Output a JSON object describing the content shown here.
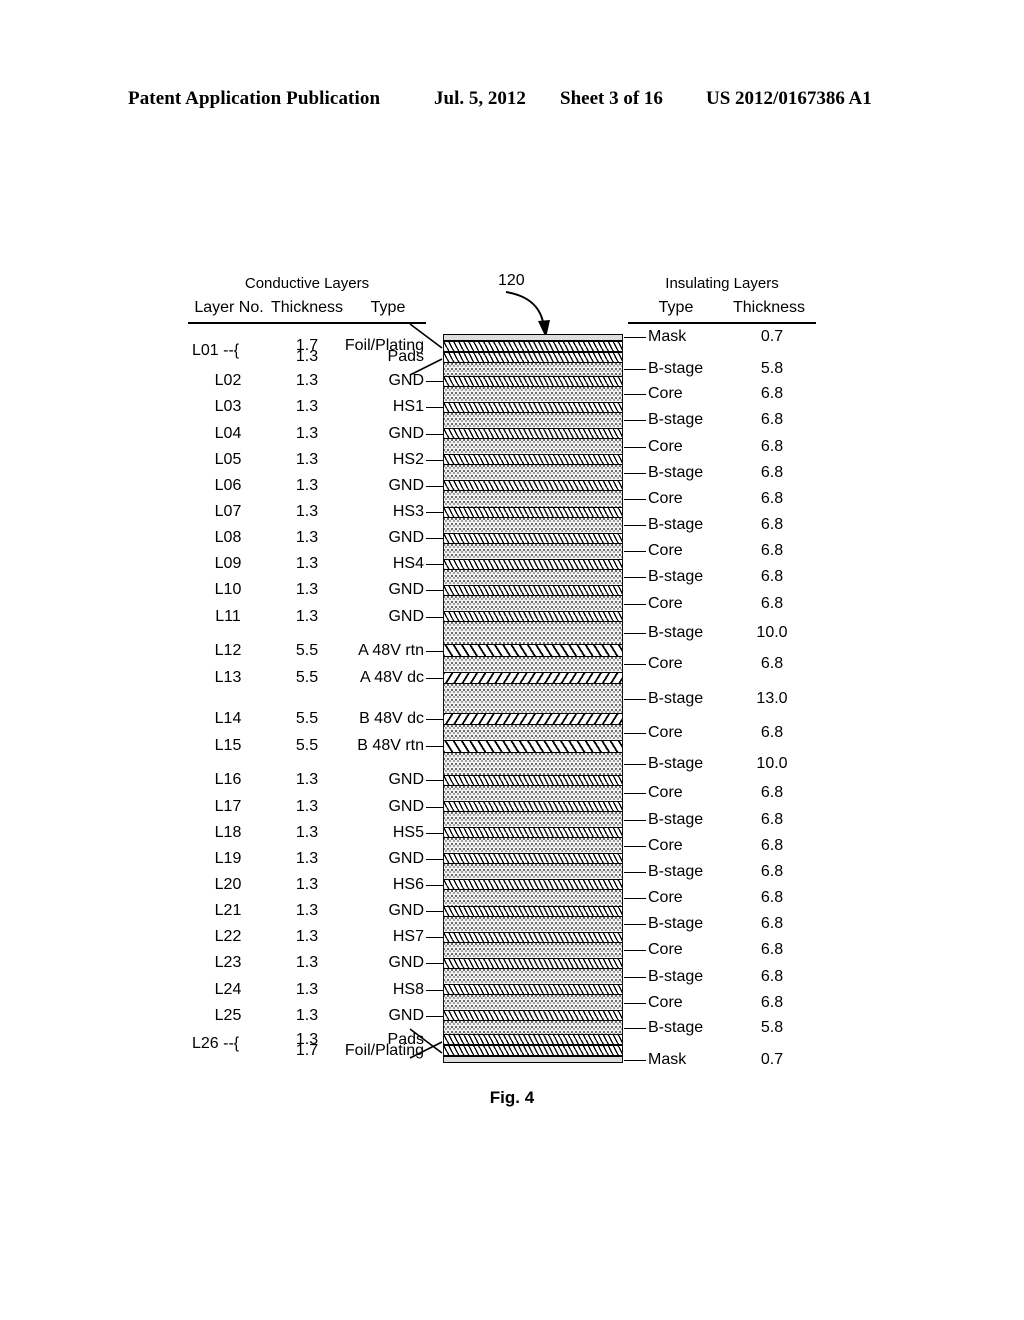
{
  "header": {
    "publication": "Patent Application Publication",
    "date": "Jul. 5, 2012",
    "sheet": "Sheet 3 of 16",
    "patent_number": "US 2012/0167386 A1"
  },
  "figure": {
    "caption": "Fig. 4",
    "callout": "120",
    "conductive_group_title": "Conductive Layers",
    "insulating_group_title": "Insulating Layers",
    "columns": {
      "layer_no": "Layer No.",
      "conductive_thickness": "Thickness",
      "conductive_type": "Type",
      "insulating_type": "Type",
      "insulating_thickness": "Thickness"
    },
    "brace_top_label": "L01 --{",
    "brace_bottom_label": "L26 --{"
  },
  "conductive_layers": [
    {
      "no": "",
      "thickness": "1.7",
      "type": "Foil/Plating"
    },
    {
      "no": "",
      "thickness": "1.3",
      "type": "Pads"
    },
    {
      "no": "L02",
      "thickness": "1.3",
      "type": "GND"
    },
    {
      "no": "L03",
      "thickness": "1.3",
      "type": "HS1"
    },
    {
      "no": "L04",
      "thickness": "1.3",
      "type": "GND"
    },
    {
      "no": "L05",
      "thickness": "1.3",
      "type": "HS2"
    },
    {
      "no": "L06",
      "thickness": "1.3",
      "type": "GND"
    },
    {
      "no": "L07",
      "thickness": "1.3",
      "type": "HS3"
    },
    {
      "no": "L08",
      "thickness": "1.3",
      "type": "GND"
    },
    {
      "no": "L09",
      "thickness": "1.3",
      "type": "HS4"
    },
    {
      "no": "L10",
      "thickness": "1.3",
      "type": "GND"
    },
    {
      "no": "L11",
      "thickness": "1.3",
      "type": "GND"
    },
    {
      "no": "L12",
      "thickness": "5.5",
      "type": "A 48V rtn"
    },
    {
      "no": "L13",
      "thickness": "5.5",
      "type": "A 48V dc"
    },
    {
      "no": "L14",
      "thickness": "5.5",
      "type": "B 48V dc"
    },
    {
      "no": "L15",
      "thickness": "5.5",
      "type": "B 48V rtn"
    },
    {
      "no": "L16",
      "thickness": "1.3",
      "type": "GND"
    },
    {
      "no": "L17",
      "thickness": "1.3",
      "type": "GND"
    },
    {
      "no": "L18",
      "thickness": "1.3",
      "type": "HS5"
    },
    {
      "no": "L19",
      "thickness": "1.3",
      "type": "GND"
    },
    {
      "no": "L20",
      "thickness": "1.3",
      "type": "HS6"
    },
    {
      "no": "L21",
      "thickness": "1.3",
      "type": "GND"
    },
    {
      "no": "L22",
      "thickness": "1.3",
      "type": "HS7"
    },
    {
      "no": "L23",
      "thickness": "1.3",
      "type": "GND"
    },
    {
      "no": "L24",
      "thickness": "1.3",
      "type": "HS8"
    },
    {
      "no": "L25",
      "thickness": "1.3",
      "type": "GND"
    },
    {
      "no": "",
      "thickness": "1.3",
      "type": "Pads"
    },
    {
      "no": "",
      "thickness": "1.7",
      "type": "Foil/Plating"
    }
  ],
  "insulating_layers": [
    {
      "type": "Mask",
      "thickness": "0.7"
    },
    {
      "type": "B-stage",
      "thickness": "5.8"
    },
    {
      "type": "Core",
      "thickness": "6.8"
    },
    {
      "type": "B-stage",
      "thickness": "6.8"
    },
    {
      "type": "Core",
      "thickness": "6.8"
    },
    {
      "type": "B-stage",
      "thickness": "6.8"
    },
    {
      "type": "Core",
      "thickness": "6.8"
    },
    {
      "type": "B-stage",
      "thickness": "6.8"
    },
    {
      "type": "Core",
      "thickness": "6.8"
    },
    {
      "type": "B-stage",
      "thickness": "6.8"
    },
    {
      "type": "Core",
      "thickness": "6.8"
    },
    {
      "type": "B-stage",
      "thickness": "10.0"
    },
    {
      "type": "Core",
      "thickness": "6.8"
    },
    {
      "type": "B-stage",
      "thickness": "13.0"
    },
    {
      "type": "Core",
      "thickness": "6.8"
    },
    {
      "type": "B-stage",
      "thickness": "10.0"
    },
    {
      "type": "Core",
      "thickness": "6.8"
    },
    {
      "type": "B-stage",
      "thickness": "6.8"
    },
    {
      "type": "Core",
      "thickness": "6.8"
    },
    {
      "type": "B-stage",
      "thickness": "6.8"
    },
    {
      "type": "Core",
      "thickness": "6.8"
    },
    {
      "type": "B-stage",
      "thickness": "6.8"
    },
    {
      "type": "Core",
      "thickness": "6.8"
    },
    {
      "type": "B-stage",
      "thickness": "6.8"
    },
    {
      "type": "Core",
      "thickness": "6.8"
    },
    {
      "type": "B-stage",
      "thickness": "5.8"
    },
    {
      "type": "Mask",
      "thickness": "0.7"
    }
  ]
}
